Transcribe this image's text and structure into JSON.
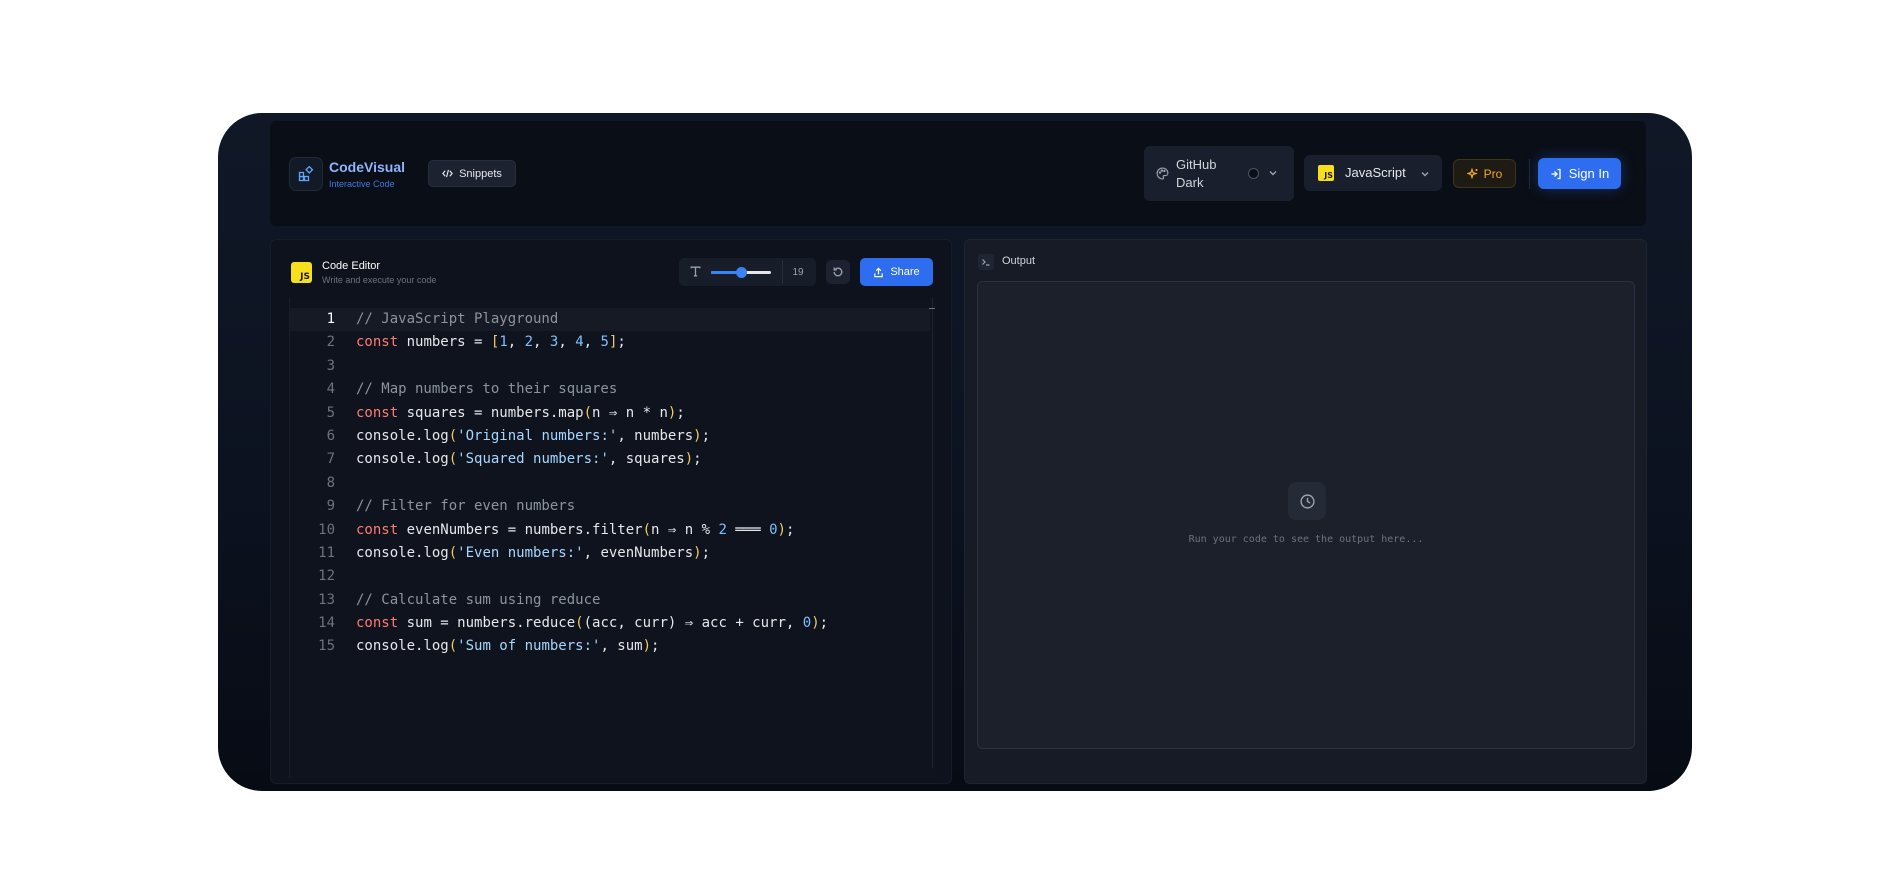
{
  "header": {
    "brand_name": "CodeVisual",
    "brand_sub": "Interactive Code",
    "snippets_label": "Snippets",
    "theme_label": "GitHub Dark",
    "language_label": "JavaScript",
    "language_badge": "JS",
    "pro_label": "Pro",
    "signin_label": "Sign In"
  },
  "editor": {
    "badge": "JS",
    "title": "Code Editor",
    "subtitle": "Write and execute your code",
    "font_size": "19",
    "font_slider_fraction": 0.5,
    "share_label": "Share",
    "active_line": 1,
    "lines": [
      [
        [
          "cm",
          "// JavaScript Playground"
        ]
      ],
      [
        [
          "kw",
          "const"
        ],
        [
          "id",
          " numbers = "
        ],
        [
          "br",
          "["
        ],
        [
          "num",
          "1"
        ],
        [
          "id",
          ", "
        ],
        [
          "num",
          "2"
        ],
        [
          "id",
          ", "
        ],
        [
          "num",
          "3"
        ],
        [
          "id",
          ", "
        ],
        [
          "num",
          "4"
        ],
        [
          "id",
          ", "
        ],
        [
          "num",
          "5"
        ],
        [
          "br",
          "]"
        ],
        [
          "id",
          ";"
        ]
      ],
      [],
      [
        [
          "cm",
          "// Map numbers to their squares"
        ]
      ],
      [
        [
          "kw",
          "const"
        ],
        [
          "id",
          " squares = numbers.map"
        ],
        [
          "br",
          "("
        ],
        [
          "id",
          "n ⇒ n * n"
        ],
        [
          "br",
          ")"
        ],
        [
          "id",
          ";"
        ]
      ],
      [
        [
          "id",
          "console.log"
        ],
        [
          "br",
          "("
        ],
        [
          "str",
          "'Original numbers:'"
        ],
        [
          "id",
          ", numbers"
        ],
        [
          "br",
          ")"
        ],
        [
          "id",
          ";"
        ]
      ],
      [
        [
          "id",
          "console.log"
        ],
        [
          "br",
          "("
        ],
        [
          "str",
          "'Squared numbers:'"
        ],
        [
          "id",
          ", squares"
        ],
        [
          "br",
          ")"
        ],
        [
          "id",
          ";"
        ]
      ],
      [],
      [
        [
          "cm",
          "// Filter for even numbers"
        ]
      ],
      [
        [
          "kw",
          "const"
        ],
        [
          "id",
          " evenNumbers = numbers.filter"
        ],
        [
          "br",
          "("
        ],
        [
          "id",
          "n ⇒ n % "
        ],
        [
          "num",
          "2"
        ],
        [
          "id",
          " ═══ "
        ],
        [
          "num",
          "0"
        ],
        [
          "br",
          ")"
        ],
        [
          "id",
          ";"
        ]
      ],
      [
        [
          "id",
          "console.log"
        ],
        [
          "br",
          "("
        ],
        [
          "str",
          "'Even numbers:'"
        ],
        [
          "id",
          ", evenNumbers"
        ],
        [
          "br",
          ")"
        ],
        [
          "id",
          ";"
        ]
      ],
      [],
      [
        [
          "cm",
          "// Calculate sum using reduce"
        ]
      ],
      [
        [
          "kw",
          "const"
        ],
        [
          "id",
          " sum = numbers.reduce"
        ],
        [
          "br",
          "("
        ],
        [
          "id",
          "(acc, curr) ⇒ acc + curr, "
        ],
        [
          "num",
          "0"
        ],
        [
          "br",
          ")"
        ],
        [
          "id",
          ";"
        ]
      ],
      [
        [
          "id",
          "console.log"
        ],
        [
          "br",
          "("
        ],
        [
          "str",
          "'Sum of numbers:'"
        ],
        [
          "id",
          ", sum"
        ],
        [
          "br",
          ")"
        ],
        [
          "id",
          ";"
        ]
      ]
    ]
  },
  "output": {
    "title": "Output",
    "placeholder": "Run your code to see the output here..."
  },
  "colors": {
    "accent": "#2f6df0",
    "keyword": "#ff7b72",
    "comment": "#8b949e",
    "number": "#79c0ff",
    "string": "#a5d6ff",
    "bracket": "#f2cc60",
    "pro": "#f5a623"
  },
  "icons": {
    "logo": "grid-shapes-icon",
    "snippets": "code-icon",
    "theme": "palette-icon",
    "pro": "sparkles-icon",
    "signin": "log-in-icon",
    "font": "type-icon",
    "reset": "rotate-ccw-icon",
    "share": "share-icon",
    "output": "terminal-icon",
    "empty": "clock-icon"
  }
}
